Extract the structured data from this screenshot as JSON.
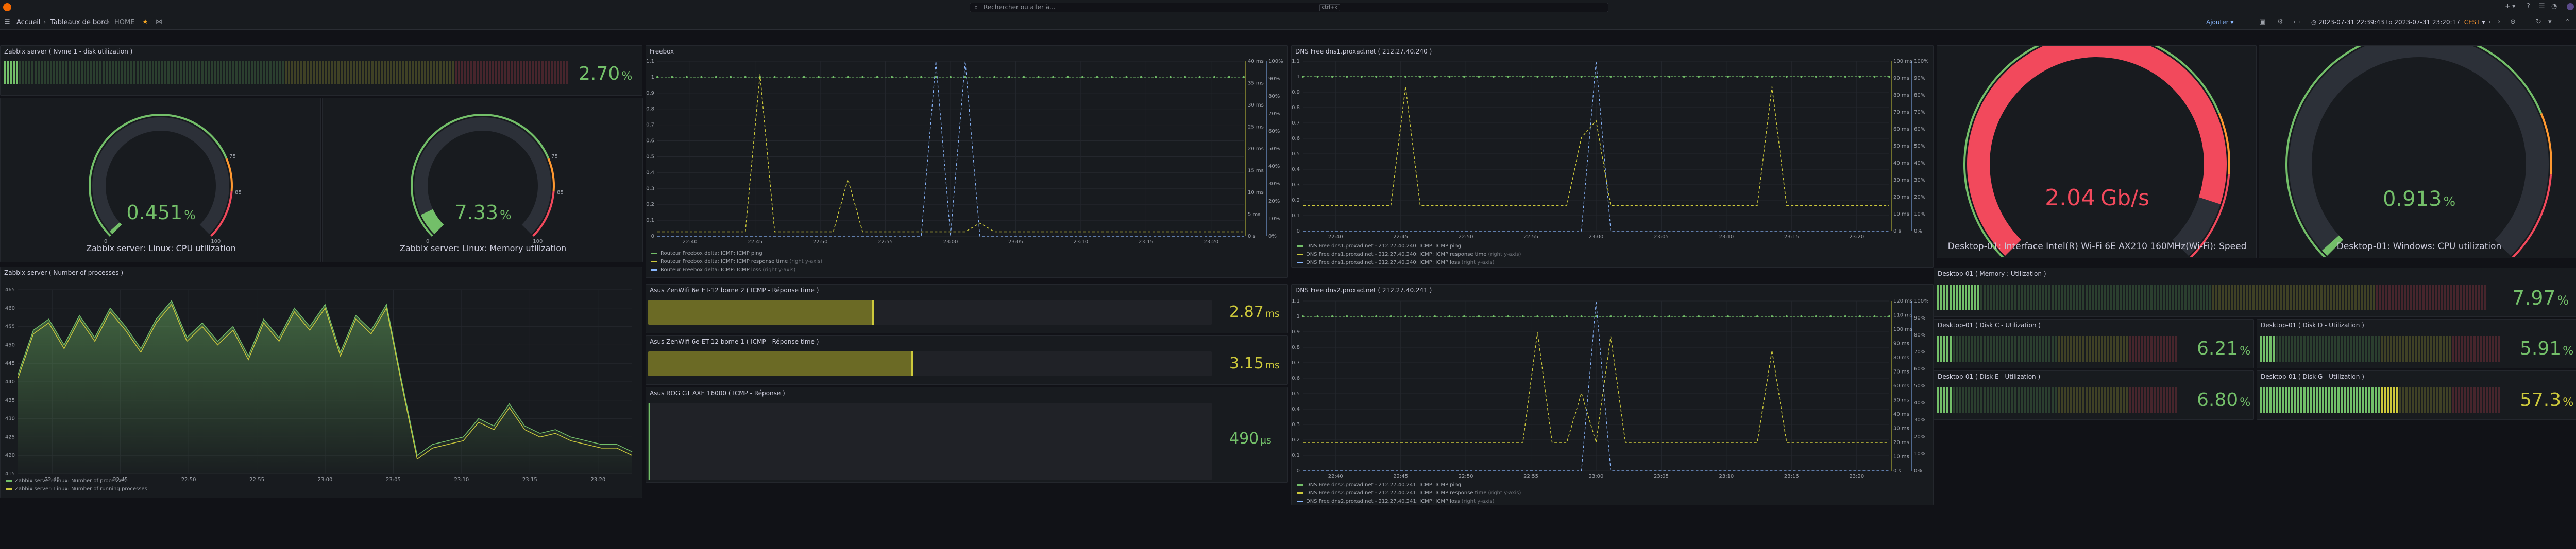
{
  "topbar": {
    "search_placeholder": "Rechercher ou aller à...",
    "search_shortcut": "ctrl+k"
  },
  "breadcrumb": {
    "home": "Accueil",
    "dashboards": "Tableaux de bord",
    "current": "HOME"
  },
  "toolbar": {
    "add_label": "Ajouter",
    "time_range": "2023-07-31 22:39:43 to 2023-07-31 23:20:17",
    "timezone": "CEST"
  },
  "colors": {
    "green": "#73bf69",
    "yellow": "#cdc93b",
    "red": "#f2495c",
    "orange": "#ff9830",
    "blue": "#8ab8ff",
    "olive": "#7a7d2b"
  },
  "panels": {
    "disk": {
      "title": "Zabbix server ( Nvme 1 - disk utilization )",
      "value": "2.70",
      "unit": "%",
      "percent": 2.7
    },
    "cpu_gauge": {
      "value": "0.451",
      "unit": "%",
      "label": "Zabbix server: Linux: CPU utilization",
      "percent": 0.451,
      "ticks": [
        "0",
        "75",
        "85",
        "100"
      ]
    },
    "mem_gauge": {
      "value": "7.33",
      "unit": "%",
      "label": "Zabbix server: Linux: Memory utilization",
      "percent": 7.33,
      "ticks": [
        "0",
        "75",
        "85",
        "100"
      ]
    },
    "processes": {
      "title": "Zabbix server ( Number of processes )",
      "legend": [
        "Zabbix server: Linux: Number of processes",
        "Zabbix server: Linux: Number of running processes"
      ]
    },
    "freebox": {
      "title": "Freebox",
      "legend": [
        {
          "name": "Routeur Freebox delta: ICMP: ICMP ping",
          "note": ""
        },
        {
          "name": "Routeur Freebox delta: ICMP: ICMP response time",
          "note": "(right y-axis)"
        },
        {
          "name": "Routeur Freebox delta: ICMP: ICMP loss",
          "note": "(right y-axis)"
        }
      ]
    },
    "dns1": {
      "title": "DNS Free dns1.proxad.net ( 212.27.40.240 )",
      "legend": [
        {
          "name": "DNS Free dns1.proxad.net - 212.27.40.240: ICMP: ICMP ping",
          "note": ""
        },
        {
          "name": "DNS Free dns1.proxad.net - 212.27.40.240: ICMP: ICMP response time",
          "note": "(right y-axis)"
        },
        {
          "name": "DNS Free dns1.proxad.net - 212.27.40.240: ICMP: ICMP loss",
          "note": "(right y-axis)"
        }
      ]
    },
    "dns2": {
      "title": "DNS Free dns2.proxad.net ( 212.27.40.241 )",
      "legend": [
        {
          "name": "DNS Free dns2.proxad.net - 212.27.40.241: ICMP: ICMP ping",
          "note": ""
        },
        {
          "name": "DNS Free dns2.proxad.net - 212.27.40.241: ICMP: ICMP response time",
          "note": "(right y-axis)"
        },
        {
          "name": "DNS Free dns2.proxad.net - 212.27.40.241: ICMP: ICMP loss",
          "note": "(right y-axis)"
        }
      ]
    },
    "asus2": {
      "title": "Asus ZenWifi 6e ET-12 borne 2 ( ICMP - Réponse time )",
      "value": "2.87",
      "unit": "ms",
      "fill": 0.4
    },
    "asus1": {
      "title": "Asus ZenWifi 6e ET-12 borne 1 ( ICMP - Réponse time )",
      "value": "3.15",
      "unit": "ms",
      "fill": 0.47
    },
    "asusrog": {
      "title": "Asus ROG GT AXE 16000 ( ICMP - Réponse )",
      "value": "490",
      "unit": "µs",
      "fill": 0.004
    },
    "wifi_gauge": {
      "value": "2.04",
      "unit": "Gb/s",
      "label": "Desktop-01: Interface Intel(R) Wi-Fi 6E AX210 160MHz(Wi-Fi): Speed",
      "fraction": 0.9
    },
    "dcpu_gauge": {
      "value": "0.913",
      "unit": "%",
      "label": "Desktop-01: Windows: CPU utilization",
      "percent": 0.913
    },
    "dmem": {
      "title": "Desktop-01 ( Memory : Utilization )",
      "value": "7.97",
      "unit": "%",
      "percent": 7.97
    },
    "diskc": {
      "title": "Desktop-01 ( Disk C - Utilization )",
      "value": "6.21",
      "unit": "%",
      "percent": 6.21
    },
    "diskd": {
      "title": "Desktop-01 ( Disk D - Utilization )",
      "value": "5.91",
      "unit": "%",
      "percent": 5.91
    },
    "diske": {
      "title": "Desktop-01 ( Disk E - Utilization )",
      "value": "6.80",
      "unit": "%",
      "percent": 6.8
    },
    "diskg": {
      "title": "Desktop-01 ( Disk G - Utilization )",
      "value": "57.3",
      "unit": "%",
      "percent": 57.3
    }
  },
  "chart_data": [
    {
      "type": "area",
      "name": "processes",
      "x": [
        "22:40",
        "22:45",
        "22:50",
        "22:55",
        "23:00",
        "23:05",
        "23:10",
        "23:15",
        "23:20"
      ],
      "ylim": [
        415,
        465
      ],
      "yticks": [
        "415",
        "420",
        "425",
        "430",
        "435",
        "440",
        "445",
        "450",
        "455",
        "460",
        "465"
      ],
      "series": [
        {
          "name": "Zabbix server: Linux: Number of processes",
          "values": [
            442,
            454,
            457,
            450,
            458,
            452,
            460,
            455,
            449,
            457,
            462,
            452,
            456,
            451,
            455,
            447,
            457,
            452,
            460,
            455,
            461,
            448,
            458,
            454,
            461,
            440,
            420,
            423,
            424,
            425,
            430,
            428,
            434,
            428,
            426,
            427,
            425,
            424,
            423,
            423,
            421
          ]
        },
        {
          "name": "Zabbix server: Linux: Number of running processes",
          "values": [
            441,
            453,
            456,
            449,
            457,
            451,
            459,
            454,
            448,
            456,
            461,
            451,
            455,
            450,
            454,
            446,
            456,
            451,
            459,
            454,
            460,
            447,
            457,
            453,
            460,
            439,
            419,
            422,
            423,
            424,
            429,
            427,
            433,
            427,
            425,
            426,
            424,
            423,
            422,
            422,
            420
          ]
        }
      ]
    },
    {
      "type": "line",
      "name": "freebox",
      "x": [
        "22:40",
        "22:45",
        "22:50",
        "22:55",
        "23:00",
        "23:05",
        "23:10",
        "23:15",
        "23:20"
      ],
      "y_left": [
        "0",
        "0.1",
        "0.2",
        "0.3",
        "0.4",
        "0.5",
        "0.6",
        "0.7",
        "0.8",
        "0.9",
        "1",
        "1.1"
      ],
      "y_right_time": [
        "0 s",
        "5 ms",
        "10 ms",
        "15 ms",
        "20 ms",
        "25 ms",
        "30 ms",
        "35 ms",
        "40 ms"
      ],
      "y_right_pct": [
        "0%",
        "10%",
        "20%",
        "30%",
        "40%",
        "50%",
        "60%",
        "70%",
        "80%",
        "90%",
        "100%"
      ],
      "ping": [
        1,
        1,
        1,
        1,
        1,
        1,
        1,
        1,
        1,
        1,
        1,
        1,
        1,
        1,
        1,
        1,
        1,
        1,
        1,
        1,
        1,
        1,
        1,
        1,
        1,
        1,
        1,
        1,
        1,
        1,
        1,
        1,
        1,
        1,
        1,
        1,
        1,
        1,
        1,
        1,
        1
      ],
      "response_ms": [
        1,
        1,
        1,
        1,
        1,
        1,
        1,
        37,
        1,
        1,
        1,
        1,
        1,
        13,
        1,
        1,
        1,
        1,
        1,
        1,
        1,
        1,
        3,
        1,
        1,
        1,
        1,
        1,
        1,
        1,
        1,
        1,
        1,
        1,
        1,
        1,
        1,
        1,
        1,
        1,
        1
      ],
      "loss_pct": [
        0,
        0,
        0,
        0,
        0,
        0,
        0,
        0,
        0,
        0,
        0,
        0,
        0,
        0,
        0,
        0,
        0,
        0,
        0,
        100,
        0,
        100,
        0,
        0,
        0,
        0,
        0,
        0,
        0,
        0,
        0,
        0,
        0,
        0,
        0,
        0,
        0,
        0,
        0,
        0,
        0
      ]
    },
    {
      "type": "line",
      "name": "dns1",
      "x": [
        "22:40",
        "22:45",
        "22:50",
        "22:55",
        "23:00",
        "23:05",
        "23:10",
        "23:15",
        "23:20"
      ],
      "y_right_time": [
        "0 s",
        "10 ms",
        "20 ms",
        "30 ms",
        "40 ms",
        "50 ms",
        "60 ms",
        "70 ms",
        "80 ms",
        "90 ms",
        "100 ms"
      ],
      "y_right_pct": [
        "0%",
        "10%",
        "20%",
        "30%",
        "40%",
        "50%",
        "60%",
        "70%",
        "80%",
        "90%",
        "100%"
      ],
      "ping": [
        1,
        1,
        1,
        1,
        1,
        1,
        1,
        1,
        1,
        1,
        1,
        1,
        1,
        1,
        1,
        1,
        1,
        1,
        1,
        1,
        1,
        1,
        1,
        1,
        1,
        1,
        1,
        1,
        1,
        1,
        1,
        1,
        1,
        1,
        1,
        1,
        1,
        1,
        1,
        1,
        1
      ],
      "response_ms": [
        15,
        15,
        15,
        15,
        15,
        15,
        15,
        85,
        15,
        15,
        15,
        15,
        15,
        15,
        15,
        15,
        15,
        15,
        15,
        55,
        65,
        15,
        15,
        15,
        15,
        15,
        15,
        15,
        15,
        15,
        15,
        15,
        85,
        15,
        15,
        15,
        15,
        15,
        15,
        15,
        15
      ],
      "loss_pct": [
        0,
        0,
        0,
        0,
        0,
        0,
        0,
        0,
        0,
        0,
        0,
        0,
        0,
        0,
        0,
        0,
        0,
        0,
        0,
        0,
        100,
        0,
        0,
        0,
        0,
        0,
        0,
        0,
        0,
        0,
        0,
        0,
        0,
        0,
        0,
        0,
        0,
        0,
        0,
        0,
        0
      ]
    },
    {
      "type": "line",
      "name": "dns2",
      "x": [
        "22:40",
        "22:45",
        "22:50",
        "22:55",
        "23:00",
        "23:05",
        "23:10",
        "23:15",
        "23:20"
      ],
      "y_right_time": [
        "0 s",
        "10 ms",
        "20 ms",
        "30 ms",
        "40 ms",
        "50 ms",
        "60 ms",
        "70 ms",
        "80 ms",
        "90 ms",
        "100 ms",
        "110 ms",
        "120 ms"
      ],
      "y_right_pct": [
        "0%",
        "10%",
        "20%",
        "30%",
        "40%",
        "50%",
        "60%",
        "70%",
        "80%",
        "90%",
        "100%"
      ],
      "ping": [
        1,
        1,
        1,
        1,
        1,
        1,
        1,
        1,
        1,
        1,
        1,
        1,
        1,
        1,
        1,
        1,
        1,
        1,
        1,
        1,
        1,
        1,
        1,
        1,
        1,
        1,
        1,
        1,
        1,
        1,
        1,
        1,
        1,
        1,
        1,
        1,
        1,
        1,
        1,
        1,
        1
      ],
      "response_ms": [
        20,
        20,
        20,
        20,
        20,
        20,
        20,
        20,
        20,
        20,
        20,
        20,
        20,
        20,
        20,
        20,
        98,
        20,
        20,
        55,
        20,
        95,
        20,
        20,
        20,
        20,
        20,
        20,
        20,
        20,
        20,
        20,
        85,
        20,
        20,
        20,
        20,
        20,
        20,
        20,
        20
      ],
      "loss_pct": [
        0,
        0,
        0,
        0,
        0,
        0,
        0,
        0,
        0,
        0,
        0,
        0,
        0,
        0,
        0,
        0,
        0,
        0,
        0,
        0,
        100,
        0,
        0,
        0,
        0,
        0,
        0,
        0,
        0,
        0,
        0,
        0,
        0,
        0,
        0,
        0,
        0,
        0,
        0,
        0,
        0
      ]
    }
  ]
}
